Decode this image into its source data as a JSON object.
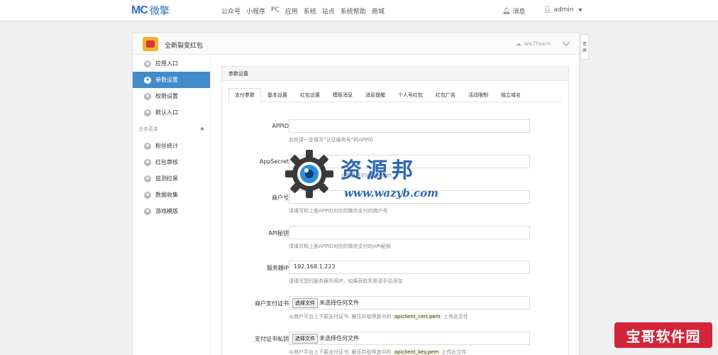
{
  "topbar": {
    "logo_mark": "MC",
    "logo_text": "微擎",
    "nav": [
      "公众号",
      "小程序",
      "PC",
      "应用",
      "系统",
      "站点",
      "系统帮助",
      "商城"
    ],
    "notify_label": "消息",
    "user_label": "admin"
  },
  "app": {
    "title": "全新裂变红包",
    "account": "we7team"
  },
  "sidebar": {
    "items": [
      {
        "label": "应用入口"
      },
      {
        "label": "参数设置"
      },
      {
        "label": "权限设置"
      },
      {
        "label": "默认入口"
      }
    ],
    "group_title": "业务菜单",
    "group_items": [
      {
        "label": "粉丝统计"
      },
      {
        "label": "红包审核"
      },
      {
        "label": "监测拉黑"
      },
      {
        "label": "数据收集"
      },
      {
        "label": "游戏模版"
      }
    ]
  },
  "side_button": {
    "line1": "宽",
    "line2": "屏"
  },
  "content": {
    "header": "参数设置",
    "tabs": [
      "支付参数",
      "基本设置",
      "红包设置",
      "模板消息",
      "消息提醒",
      "个人号红包",
      "红包广告",
      "活动限制",
      "独立域名"
    ],
    "active_tab": 0,
    "fields": {
      "appid": {
        "label": "APPID",
        "value": "",
        "help": "此处请一定填写“认证服务号”的APPID"
      },
      "appsecret": {
        "label": "AppSecret",
        "value": "",
        "help_pre": "此处",
        "help_mid": "证服务号",
        "help_post": "的AppSecret"
      },
      "merchant": {
        "label": "商户号",
        "value": "",
        "help": "请填写和上面APPID对应的微信支付的商户号"
      },
      "apikey": {
        "label": "API秘钥",
        "value": "",
        "help": "请填写和上面APPID对应的微信支付的API秘钥"
      },
      "server_ip": {
        "label": "服务器IP",
        "value": "192.168.1.223",
        "help": "请填写您的服务器外网IP，如果获取失败请手动添加"
      },
      "cert": {
        "label": "商户支付证书",
        "button": "选择文件",
        "status": "未选择任何文件",
        "help_pre": "从商户平台上下载支付证书, 解压并取得其中的",
        "code": "apiclient_cert.pem",
        "help_post": "上传此文件"
      },
      "key": {
        "label": "支付证书私钥",
        "button": "选择文件",
        "status": "未选择任何文件",
        "help_pre": "从商户平台上下载支付证书, 解压并取得其中的",
        "code": "apiclient_key.pem",
        "help_post": "上传此文件"
      }
    }
  },
  "watermark": {
    "cn": "资源邦",
    "url": "www.wazyb.com"
  },
  "badge": {
    "text": "宝哥软件园"
  },
  "colors": {
    "active": "#428bca",
    "brand": "#2f6fbf",
    "watermark": "#2c67b4",
    "badge": "#d3243a"
  }
}
